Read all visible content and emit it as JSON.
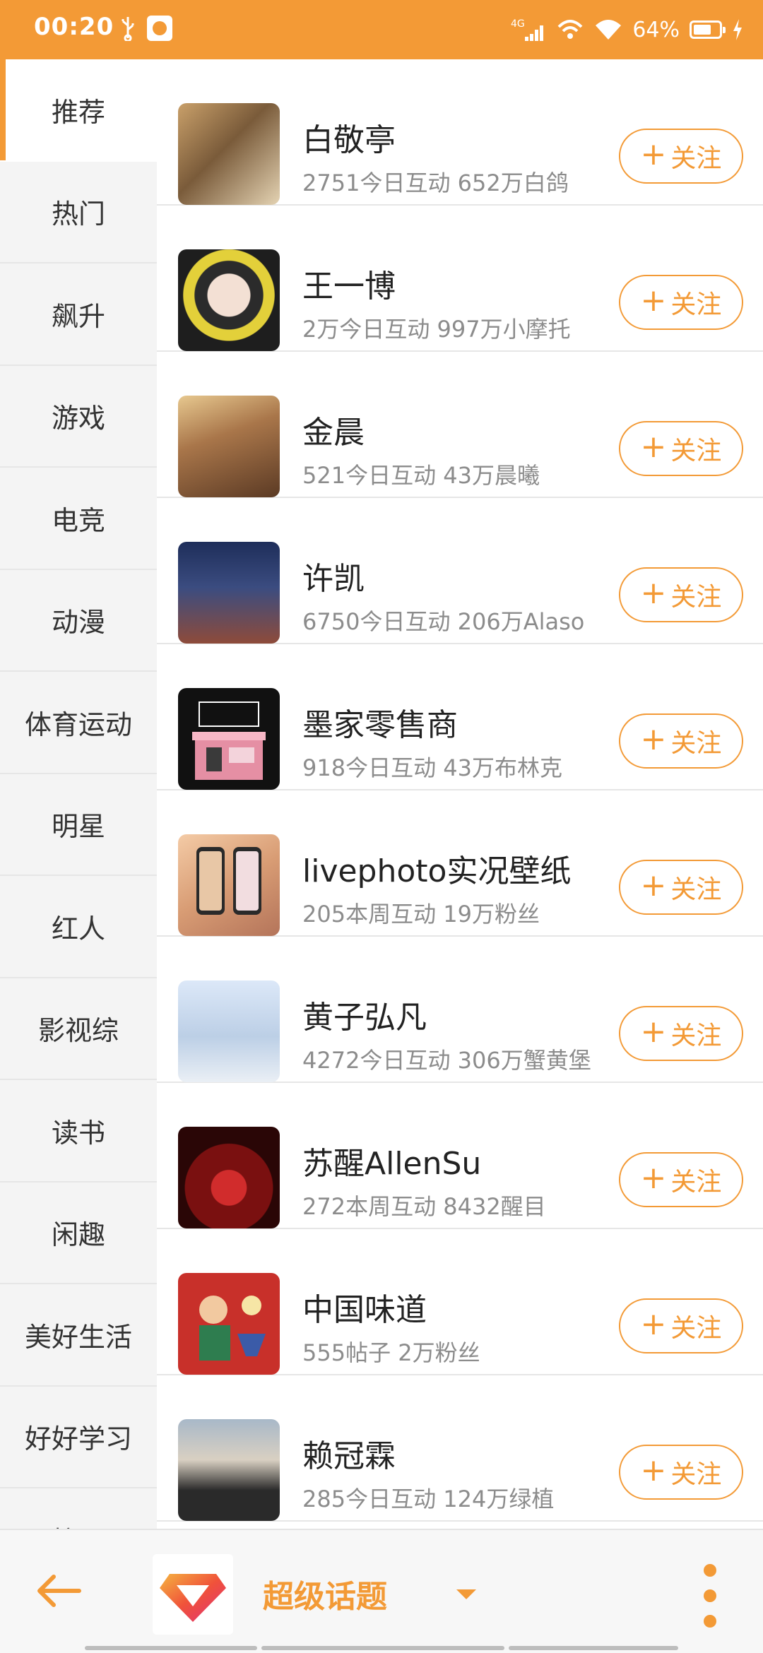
{
  "status_bar": {
    "time": "00:20",
    "network": "4G",
    "battery_percent": "64%"
  },
  "sidebar": {
    "items": [
      {
        "label": "推荐",
        "active": true
      },
      {
        "label": "热门"
      },
      {
        "label": "飙升"
      },
      {
        "label": "游戏"
      },
      {
        "label": "电竞"
      },
      {
        "label": "动漫"
      },
      {
        "label": "体育运动"
      },
      {
        "label": "明星"
      },
      {
        "label": "红人"
      },
      {
        "label": "影视综"
      },
      {
        "label": "读书"
      },
      {
        "label": "闲趣"
      },
      {
        "label": "美好生活"
      },
      {
        "label": "好好学习"
      },
      {
        "label": "校园"
      }
    ]
  },
  "topics": {
    "follow_label": "关注",
    "items": [
      {
        "name": "白敬亭",
        "meta": "2751今日互动 652万白鸽"
      },
      {
        "name": "王一博",
        "meta": "2万今日互动 997万小摩托"
      },
      {
        "name": "金晨",
        "meta": "521今日互动 43万晨曦"
      },
      {
        "name": "许凯",
        "meta": "6750今日互动 206万Alaso"
      },
      {
        "name": "墨家零售商",
        "meta": "918今日互动 43万布林克"
      },
      {
        "name": "livephoto实况壁纸",
        "meta": "205本周互动 19万粉丝"
      },
      {
        "name": "黄子弘凡",
        "meta": "4272今日互动 306万蟹黄堡"
      },
      {
        "name": "苏醒AllenSu",
        "meta": "272本周互动 8432醒目"
      },
      {
        "name": "中国味道",
        "meta": "555帖子 2万粉丝"
      },
      {
        "name": "赖冠霖",
        "meta": "285今日互动 124万绿植"
      }
    ]
  },
  "bottom_bar": {
    "title": "超级话题"
  },
  "colors": {
    "accent": "#F39A36",
    "sidebar_bg": "#F4F4F4",
    "meta_text": "#8C8C8C"
  }
}
